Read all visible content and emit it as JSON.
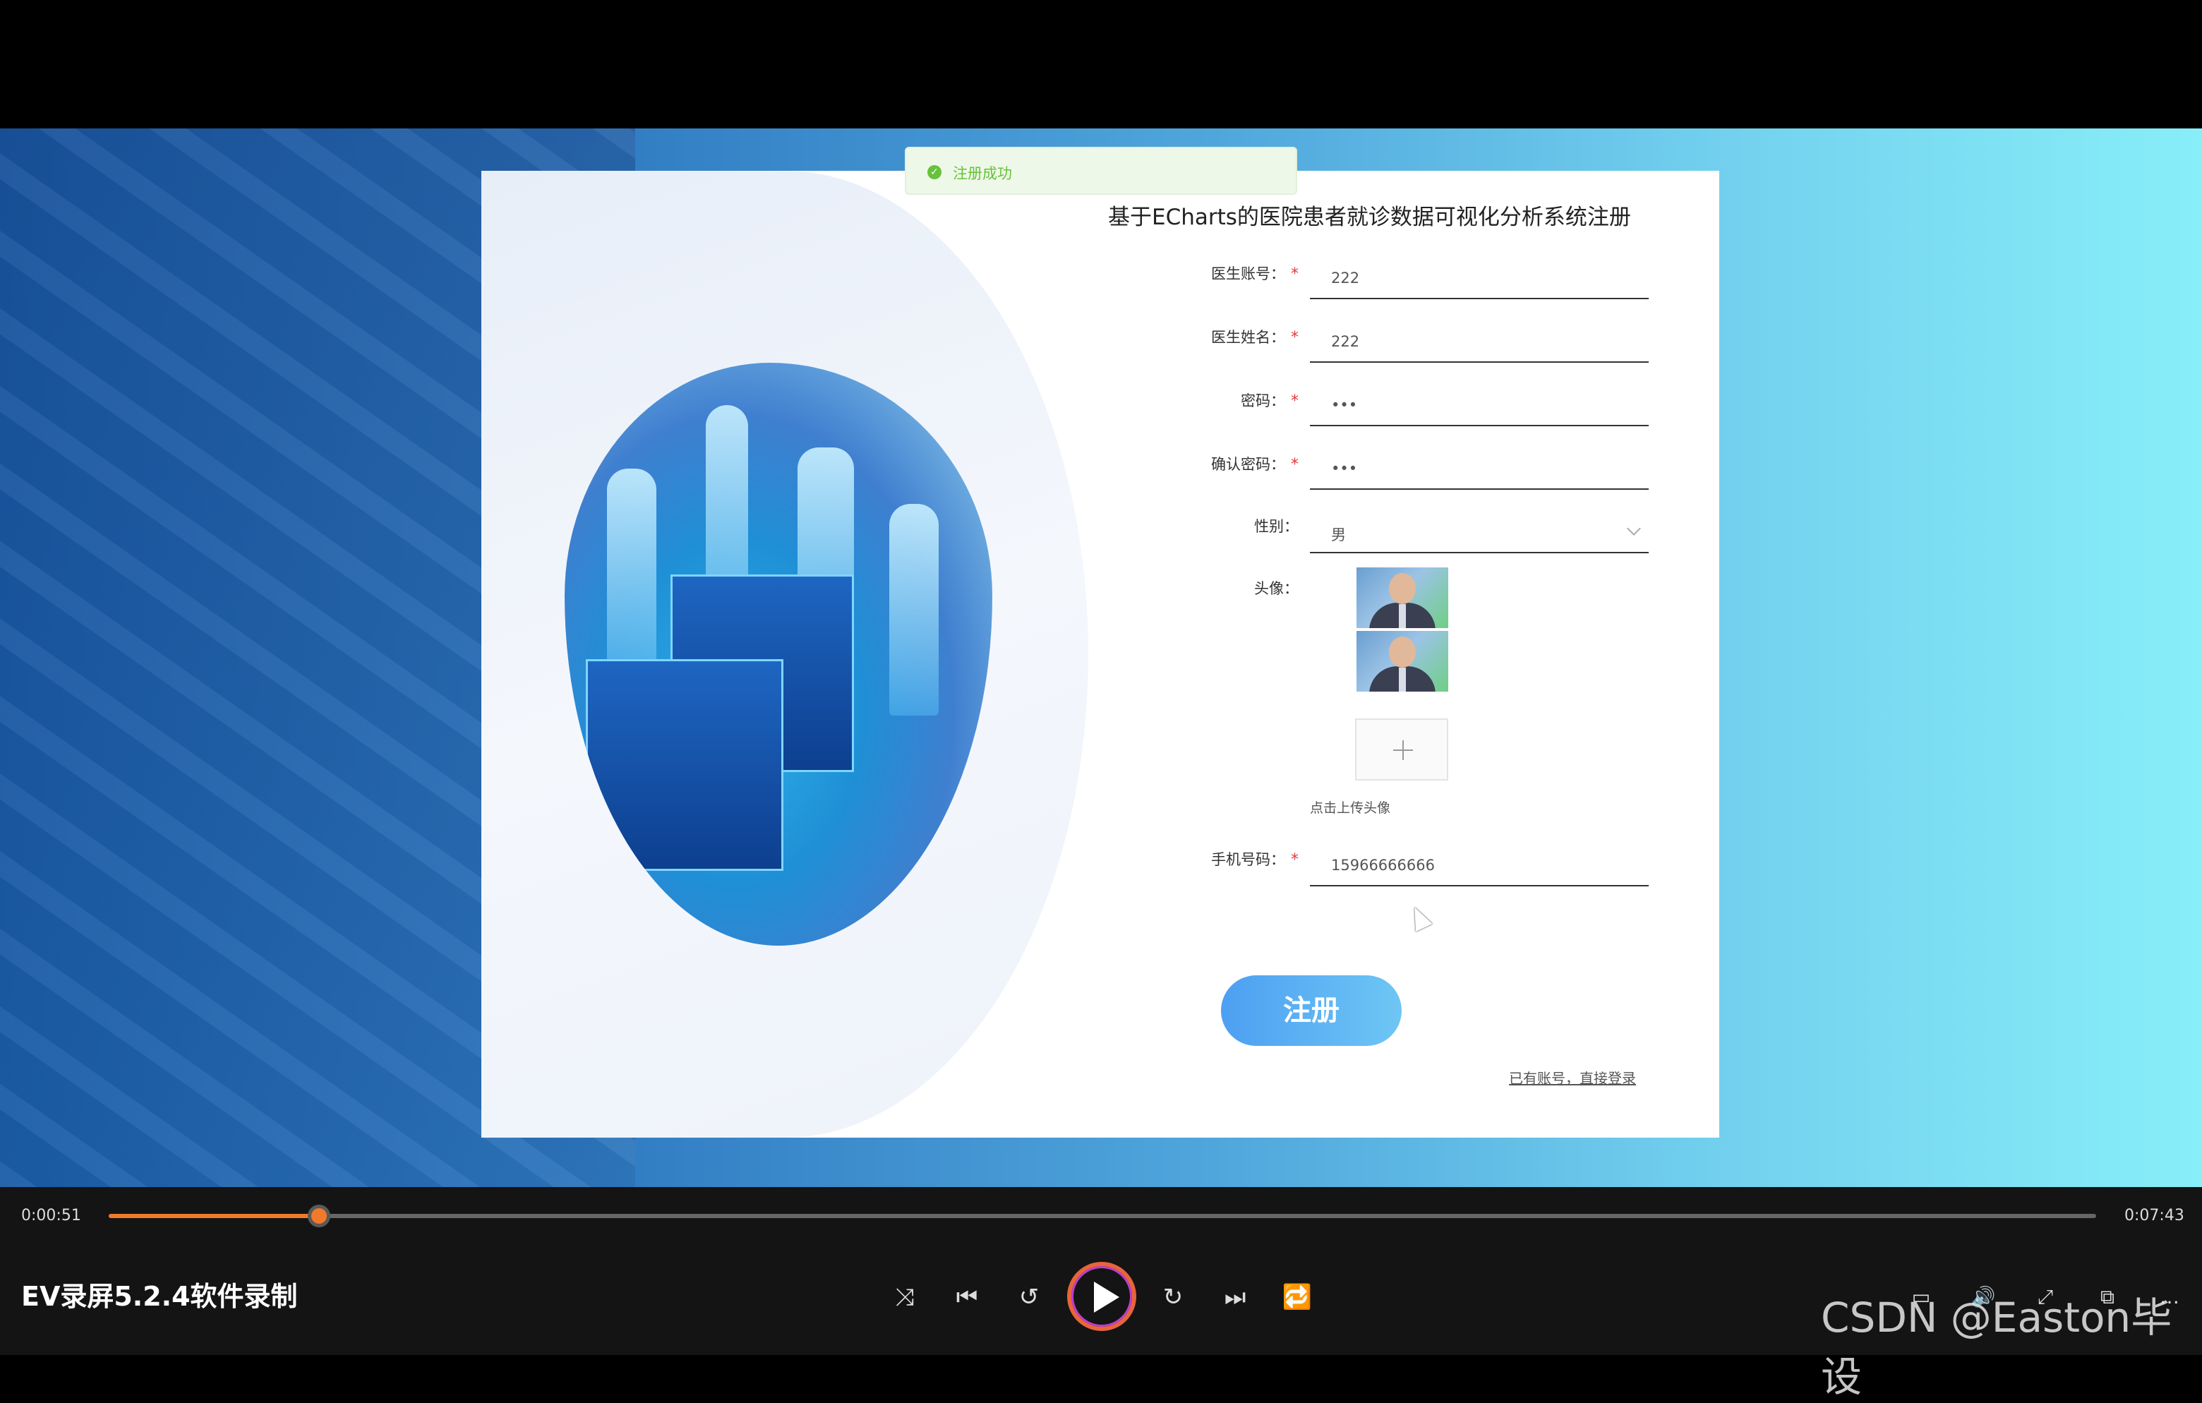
{
  "form": {
    "title": "基于ECharts的医院患者就诊数据可视化分析系统注册",
    "fields": [
      {
        "label": "医生账号：",
        "value": "222",
        "required": true
      },
      {
        "label": "医生姓名：",
        "value": "222",
        "required": true
      },
      {
        "label": "密码：",
        "value": "•••",
        "required": true
      },
      {
        "label": "确认密码：",
        "value": "•••",
        "required": true
      },
      {
        "label": "性别：",
        "value": "男",
        "required": false
      }
    ],
    "avatar_label": "头像：",
    "upload_hint": "点击上传头像",
    "phone_label": "手机号码：",
    "phone_value": "15966666666",
    "required_mark": "*",
    "register_label": "注册",
    "login_link": "已有账号，直接登录"
  },
  "toast": {
    "text": "注册成功",
    "icon": "check-circle-icon",
    "color": "#67c23a"
  },
  "player": {
    "current_time": "0:00:51",
    "total_time": "0:07:43",
    "progress": 0.106,
    "app_name": "EV录屏5.2.4软件录制",
    "accent": "#f07a2a"
  },
  "watermark": "CSDN @Easton毕设"
}
